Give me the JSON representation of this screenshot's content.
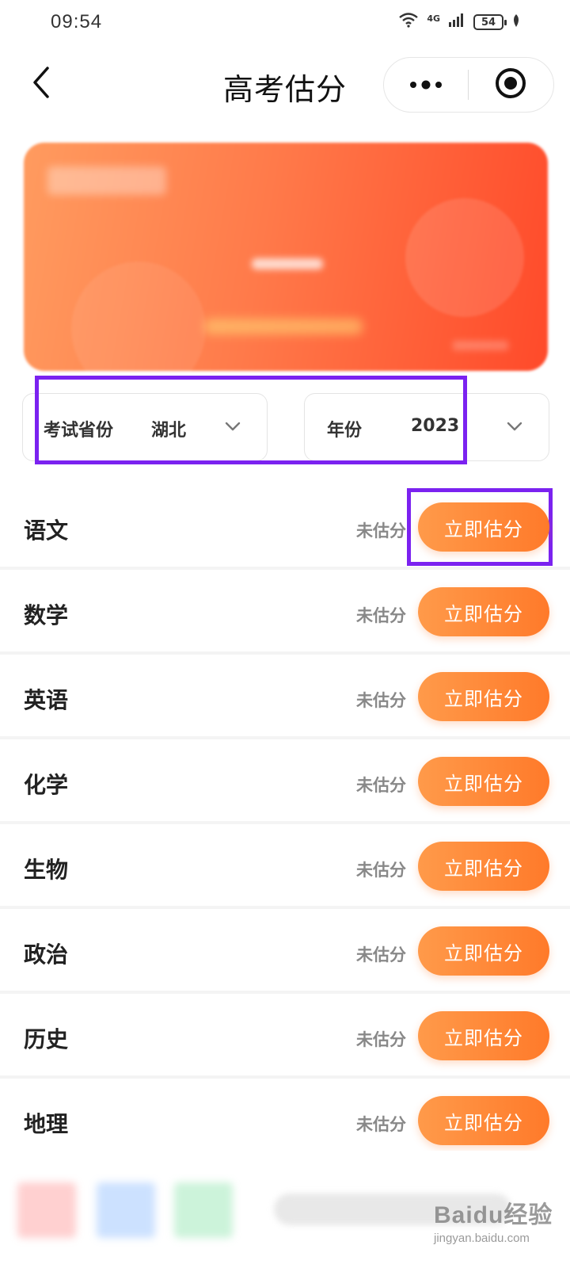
{
  "status_bar": {
    "time": "09:54",
    "network": "4G",
    "battery": "54"
  },
  "nav": {
    "title": "高考估分"
  },
  "selectors": {
    "province_label": "考试省份",
    "province_value": "湖北",
    "year_label": "年份",
    "year_value": "2023"
  },
  "subjects": [
    {
      "name": "语文",
      "status": "未估分",
      "action": "立即估分"
    },
    {
      "name": "数学",
      "status": "未估分",
      "action": "立即估分"
    },
    {
      "name": "英语",
      "status": "未估分",
      "action": "立即估分"
    },
    {
      "name": "化学",
      "status": "未估分",
      "action": "立即估分"
    },
    {
      "name": "生物",
      "status": "未估分",
      "action": "立即估分"
    },
    {
      "name": "政治",
      "status": "未估分",
      "action": "立即估分"
    },
    {
      "name": "历史",
      "status": "未估分",
      "action": "立即估分"
    },
    {
      "name": "地理",
      "status": "未估分",
      "action": "立即估分"
    }
  ],
  "watermark": {
    "main": "Baidu经验",
    "sub": "jingyan.baidu.com"
  },
  "colors": {
    "accent_orange": "#ff7a2a",
    "highlight_purple": "#7b22f0",
    "banner_start": "#ff9b5f",
    "banner_end": "#ff4a2a"
  },
  "icons": {
    "back": "chevron-left-icon",
    "more": "more-dots-icon",
    "close": "target-circle-icon",
    "dropdown": "chevron-down-icon"
  }
}
